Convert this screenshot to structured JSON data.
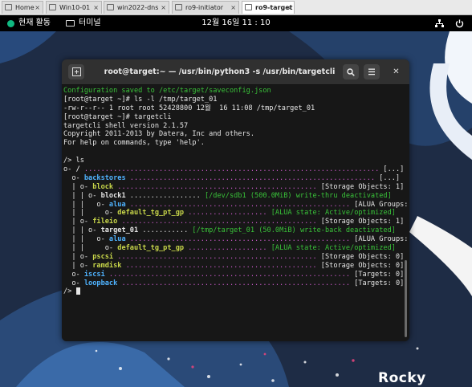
{
  "browser_tabs": [
    {
      "label": "Home",
      "active": false
    },
    {
      "label": "Win10-01",
      "active": false
    },
    {
      "label": "win2022-dns",
      "active": false
    },
    {
      "label": "ro9-initiator",
      "active": false
    },
    {
      "label": "ro9-target",
      "active": true
    }
  ],
  "topbar": {
    "activities": "현재 활동",
    "app_name": "터미널",
    "clock": "12월 16일  11 : 10"
  },
  "window": {
    "title": "root@target:~ — /usr/bin/python3 -s /usr/bin/targetcli"
  },
  "wallpaper_logo": "Rocky",
  "colors": {
    "accent": "#10b981",
    "terminal_bg": "#171717",
    "green": "#39c239",
    "cyan": "#4fb3ff",
    "magenta": "#cc5bcc",
    "yellow": "#c8d64a"
  },
  "terminal": {
    "lines": [
      [
        [
          "g",
          "Configuration saved to /etc/target/saveconfig.json"
        ]
      ],
      [
        [
          "w",
          "[root@target ~]# ls -l /tmp/target_01"
        ]
      ],
      [
        [
          "w",
          "-rw-r--r-- 1 root root 52428800 12월  16 11:08 /tmp/target_01"
        ]
      ],
      [
        [
          "w",
          "[root@target ~]# targetcli"
        ]
      ],
      [
        [
          "w",
          "targetcli shell version 2.1.57"
        ]
      ],
      [
        [
          "w",
          "Copyright 2011-2013 by Datera, Inc and others."
        ]
      ],
      [
        [
          "w",
          "For help on commands, type 'help'."
        ]
      ],
      [
        [
          "w",
          ""
        ]
      ],
      [
        [
          "w",
          "/> ls"
        ]
      ],
      [
        [
          "w",
          "o- "
        ],
        [
          "b",
          "/"
        ],
        [
          "dot",
          " ....................................................................... "
        ],
        [
          "w",
          "[...]"
        ]
      ],
      [
        [
          "w",
          "  o- "
        ],
        [
          "c",
          "backstores"
        ],
        [
          "dot",
          " ........................................................... "
        ],
        [
          "w",
          "[...]"
        ]
      ],
      [
        [
          "w",
          "  | o- "
        ],
        [
          "y",
          "block"
        ],
        [
          "dot",
          " ................................................ "
        ],
        [
          "w",
          "[Storage Objects: 1]"
        ]
      ],
      [
        [
          "w",
          "  | | o- "
        ],
        [
          "b",
          "block1"
        ],
        [
          "w",
          " ................. "
        ],
        [
          "g",
          "[/dev/sdb1 (500.0MiB) write-thru deactivated]"
        ]
      ],
      [
        [
          "w",
          "  | |   o- "
        ],
        [
          "c",
          "alua"
        ],
        [
          "dot",
          " ..................................................... "
        ],
        [
          "w",
          "[ALUA Groups: 1]"
        ]
      ],
      [
        [
          "w",
          "  | |     o- "
        ],
        [
          "y",
          "default_tg_pt_gp"
        ],
        [
          "dot",
          " ................... "
        ],
        [
          "g",
          "[ALUA state: Active/optimized]"
        ]
      ],
      [
        [
          "w",
          "  | o- "
        ],
        [
          "y",
          "fileio"
        ],
        [
          "dot",
          " ............................................... "
        ],
        [
          "w",
          "[Storage Objects: 1]"
        ]
      ],
      [
        [
          "w",
          "  | | o- "
        ],
        [
          "b",
          "target_01"
        ],
        [
          "w",
          " ........... "
        ],
        [
          "g",
          "[/tmp/target_01 (50.0MiB) write-back deactivated]"
        ]
      ],
      [
        [
          "w",
          "  | |   o- "
        ],
        [
          "c",
          "alua"
        ],
        [
          "dot",
          " ..................................................... "
        ],
        [
          "w",
          "[ALUA Groups: 1]"
        ]
      ],
      [
        [
          "w",
          "  | |     o- "
        ],
        [
          "y",
          "default_tg_pt_gp"
        ],
        [
          "dot",
          " ................... "
        ],
        [
          "g",
          "[ALUA state: Active/optimized]"
        ]
      ],
      [
        [
          "w",
          "  | o- "
        ],
        [
          "y",
          "pscsi"
        ],
        [
          "dot",
          " ................................................ "
        ],
        [
          "w",
          "[Storage Objects: 0]"
        ]
      ],
      [
        [
          "w",
          "  | o- "
        ],
        [
          "y",
          "ramdisk"
        ],
        [
          "dot",
          " .............................................. "
        ],
        [
          "w",
          "[Storage Objects: 0]"
        ]
      ],
      [
        [
          "w",
          "  o- "
        ],
        [
          "c",
          "iscsi"
        ],
        [
          "dot",
          " .......................................................... "
        ],
        [
          "w",
          "[Targets: 0]"
        ]
      ],
      [
        [
          "w",
          "  o- "
        ],
        [
          "c",
          "loopback"
        ],
        [
          "dot",
          " ....................................................... "
        ],
        [
          "w",
          "[Targets: 0]"
        ]
      ],
      [
        [
          "w",
          "/> "
        ]
      ]
    ]
  }
}
